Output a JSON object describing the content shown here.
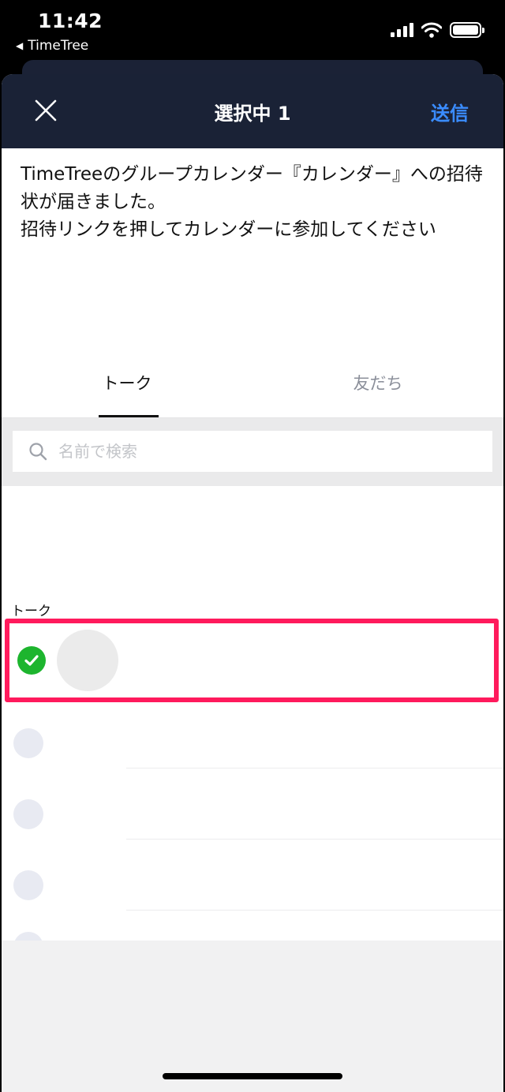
{
  "status_bar": {
    "time": "11:42",
    "back_app": "TimeTree",
    "back_icon": "back-triangle-icon",
    "icons": [
      "signal-icon",
      "wifi-icon",
      "battery-icon"
    ]
  },
  "nav": {
    "title": "選択中 1",
    "send_label": "送信",
    "close_icon": "close-icon"
  },
  "message": {
    "text": "TimeTreeのグループカレンダー『カレンダー』への招待状が届きました。\n招待リンクを押してカレンダーに参加してください"
  },
  "tabs": [
    {
      "label": "トーク",
      "active": true
    },
    {
      "label": "友だち",
      "active": false
    }
  ],
  "search": {
    "placeholder": "名前で検索",
    "value": ""
  },
  "list": {
    "section_label": "トーク",
    "selected_row": {
      "checked": true
    }
  },
  "colors": {
    "nav_bg": "#1a2236",
    "send": "#3a8cff",
    "check": "#1db52e",
    "highlight": "#ff1a5c"
  }
}
